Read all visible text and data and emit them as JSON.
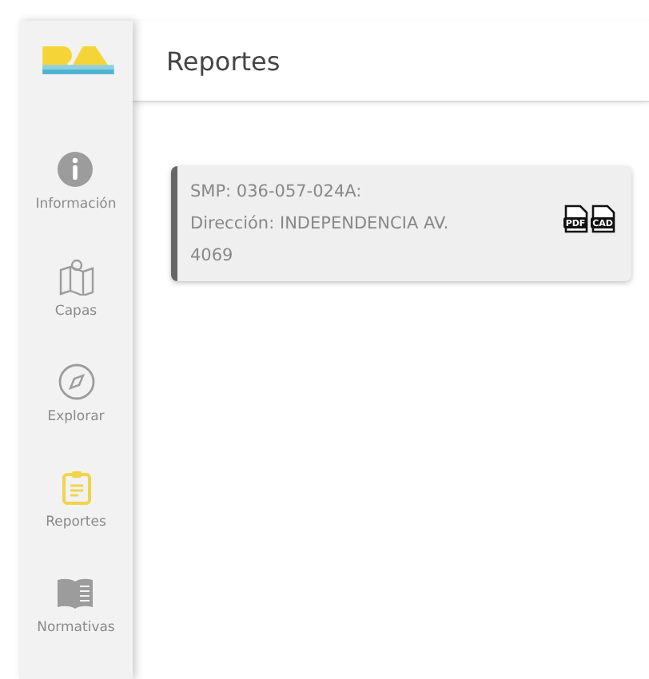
{
  "sidebar": {
    "items": [
      {
        "kind": "info",
        "label": "Información",
        "selected": false
      },
      {
        "kind": "map",
        "label": "Capas",
        "selected": false
      },
      {
        "kind": "compass",
        "label": "Explorar",
        "selected": false
      },
      {
        "kind": "clipboard",
        "label": "Reportes",
        "selected": true
      },
      {
        "kind": "book",
        "label": "Normativas",
        "selected": false
      }
    ]
  },
  "header": {
    "title": "Reportes"
  },
  "reports": [
    {
      "lines": [
        "SMP: 036-057-024A:",
        "Dirección: INDEPENDENCIA AV.",
        "4069"
      ],
      "files": [
        {
          "label": "PDF"
        },
        {
          "label": "CAD"
        }
      ]
    }
  ]
}
